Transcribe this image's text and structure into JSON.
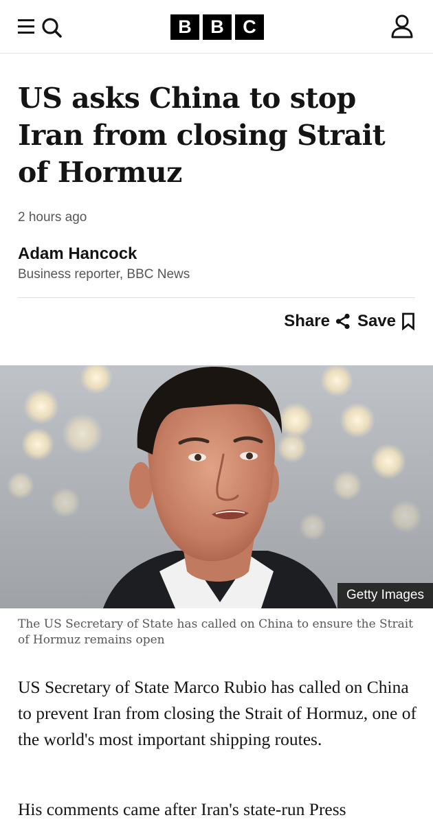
{
  "header": {
    "logo_letters": [
      "B",
      "B",
      "C"
    ],
    "menu_icon": "menu-search-icon",
    "account_icon": "user-icon"
  },
  "article": {
    "headline": "US asks China to stop Iran from closing Strait of Hormuz",
    "timestamp": "2 hours ago",
    "author": {
      "name": "Adam Hancock",
      "role": "Business reporter, BBC News"
    },
    "actions": {
      "share_label": "Share",
      "share_icon": "share-icon",
      "save_label": "Save",
      "save_icon": "bookmark-icon"
    },
    "image": {
      "credit": "Getty Images",
      "caption": "The US Secretary of State has called on China to ensure the Strait of Hormuz remains open"
    },
    "paragraphs": [
      "US Secretary of State Marco Rubio has called on China to prevent Iran from closing the Strait of Hormuz, one of the world's most important shipping routes.",
      "His comments came after Iran's state-run Press"
    ]
  }
}
